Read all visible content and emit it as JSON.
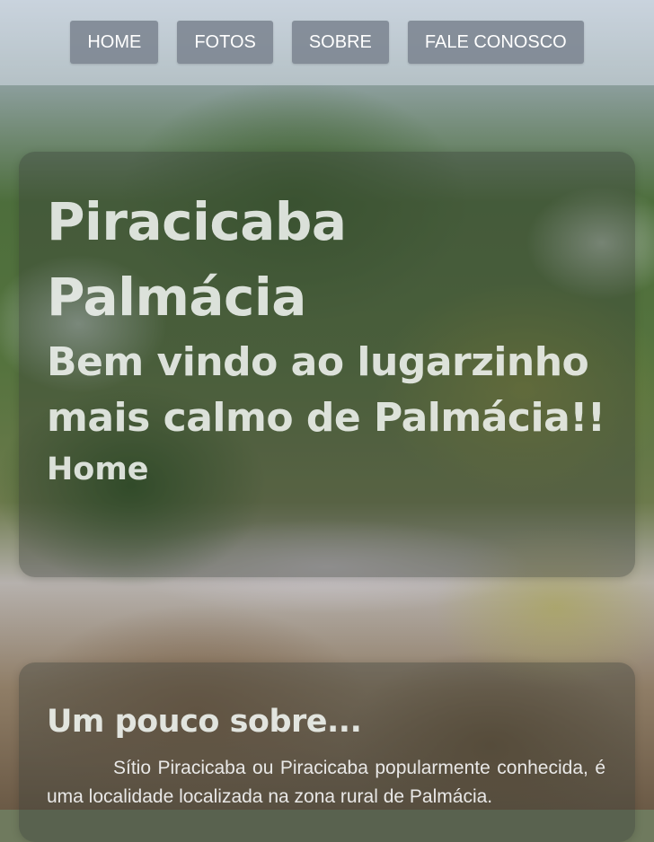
{
  "nav": {
    "items": [
      {
        "label": "HOME"
      },
      {
        "label": "FOTOS"
      },
      {
        "label": "SOBRE"
      },
      {
        "label": "FALE CONOSCO"
      }
    ]
  },
  "hero": {
    "title": "Piracicaba Palmácia",
    "subtitle": "Bem vindo ao lugarzinho mais calmo de Palmácia!!",
    "page_name": "Home"
  },
  "about": {
    "title": "Um pouco sobre...",
    "text": "Sítio Piracicaba ou Piracicaba popularmente conhecida, é uma localidade localizada na zona rural de Palmácia."
  },
  "colors": {
    "nav_button_bg": "#78808c",
    "nav_button_text": "#ffffff",
    "card_overlay": "#373c37",
    "heading_text": "#f0f4f0"
  }
}
